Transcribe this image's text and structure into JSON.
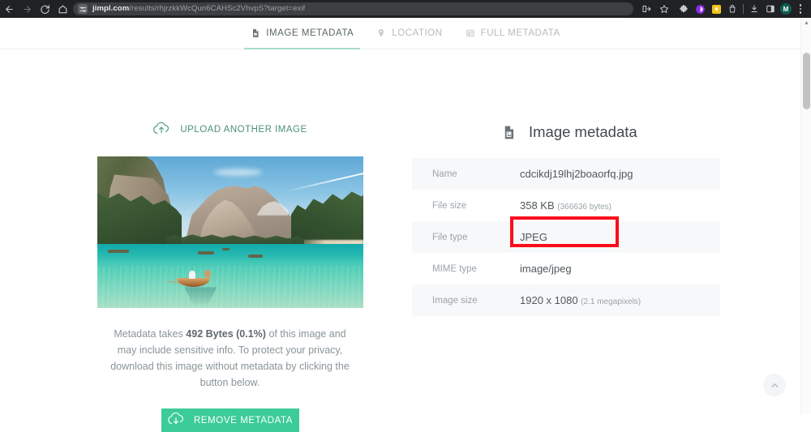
{
  "browser": {
    "back_icon": "back-arrow-icon",
    "forward_icon": "forward-arrow-icon",
    "reload_icon": "reload-icon",
    "home_icon": "home-icon",
    "url_host": "jimpl.com",
    "url_path": "/results/rhjrzkkWcQun6CAHSc2VhvpS?target=exif",
    "url_full": "jimpl.com/results/rhjrzkkWcQun6CAHSc2VhvpS?target=exif",
    "site_settings_icon": "tune-sliders-icon",
    "actions": [
      {
        "name": "share-this-tab-icon",
        "label": "share-this-tab"
      },
      {
        "name": "bookmark-star-icon",
        "label": "bookmark"
      }
    ],
    "extensions": [
      {
        "name": "extension-puzzle-icon",
        "color": "#c9ccce"
      },
      {
        "name": "extension-purple-circle-icon",
        "color": "#8a2be2"
      },
      {
        "name": "extension-yellow-square-icon",
        "color": "#f2c319"
      },
      {
        "name": "extension-bag-icon",
        "color": "#c9ccce"
      }
    ],
    "downloads_icon": "download-icon",
    "side_panel_icon": "side-panel-icon",
    "avatar_initial": "M",
    "menu_icon": "three-dot-menu-icon"
  },
  "tabs": [
    {
      "id": "image-metadata",
      "label": "IMAGE METADATA",
      "icon": "document-image-icon",
      "active": true
    },
    {
      "id": "location",
      "label": "LOCATION",
      "icon": "map-pin-icon",
      "active": false
    },
    {
      "id": "full-metadata",
      "label": "FULL METADATA",
      "icon": "table-list-icon",
      "active": false
    }
  ],
  "left": {
    "upload_label": "UPLOAD ANOTHER IMAGE",
    "upload_icon": "cloud-upload-icon",
    "preview_alt": "lake-with-mountains-and-rowboat-photo",
    "note_prefix": "Metadata takes ",
    "note_bold": "492 Bytes (0.1%)",
    "note_suffix": " of this image and may include sensitive info. To protect your privacy, download this image without metadata by clicking the button below.",
    "remove_label": "REMOVE METADATA",
    "remove_icon": "cloud-download-icon",
    "remove_color": "#3ccc97"
  },
  "right": {
    "panel_icon": "document-image-icon",
    "panel_title": "Image metadata",
    "rows": [
      {
        "key": "Name",
        "value": "cdcikdj19lhj2boaorfq.jpg",
        "sub": "",
        "shaded": true,
        "highlighted": false
      },
      {
        "key": "File size",
        "value": "358 KB",
        "sub": "(366636 bytes)",
        "shaded": false,
        "highlighted": true
      },
      {
        "key": "File type",
        "value": "JPEG",
        "sub": "",
        "shaded": true,
        "highlighted": false
      },
      {
        "key": "MIME type",
        "value": "image/jpeg",
        "sub": "",
        "shaded": false,
        "highlighted": false
      },
      {
        "key": "Image size",
        "value": "1920 x 1080",
        "sub": "(2.1 megapixels)",
        "shaded": true,
        "highlighted": false
      }
    ],
    "highlight_color": "#fc0d1b"
  },
  "misc": {
    "scroll_top_icon": "chevron-up-icon",
    "scrollbar_up_arrow_icon": "scroll-up-arrow-icon"
  }
}
